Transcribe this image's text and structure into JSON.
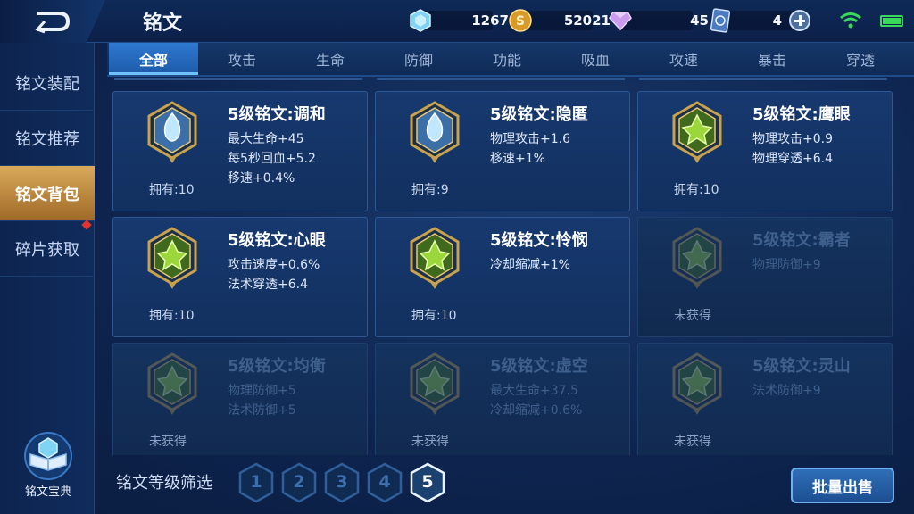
{
  "header": {
    "title": "铭文",
    "resources": [
      {
        "name": "crystal",
        "icon": "crystal-icon",
        "value": "1267"
      },
      {
        "name": "gold",
        "icon": "coin-icon",
        "value": "52021"
      },
      {
        "name": "diamond",
        "icon": "diamond-icon",
        "value": "45"
      },
      {
        "name": "card",
        "icon": "card-icon",
        "value": "4"
      }
    ]
  },
  "leftnav": {
    "items": [
      {
        "label": "铭文装配"
      },
      {
        "label": "铭文推荐"
      },
      {
        "label": "铭文背包",
        "active": true
      },
      {
        "label": "碎片获取"
      }
    ],
    "codex_label": "铭文宝典"
  },
  "tabs": [
    {
      "label": "全部",
      "active": true
    },
    {
      "label": "攻击"
    },
    {
      "label": "生命"
    },
    {
      "label": "防御"
    },
    {
      "label": "功能"
    },
    {
      "label": "吸血"
    },
    {
      "label": "攻速"
    },
    {
      "label": "暴击"
    },
    {
      "label": "穿透"
    }
  ],
  "cards": [
    {
      "name": "5级铭文:调和",
      "attrs": [
        "最大生命+45",
        "每5秒回血+5.2",
        "移速+0.4%"
      ],
      "owned": "拥有:10",
      "color": "blue",
      "obtained": true
    },
    {
      "name": "5级铭文:隐匿",
      "attrs": [
        "物理攻击+1.6",
        "移速+1%"
      ],
      "owned": "拥有:9",
      "color": "blue",
      "obtained": true
    },
    {
      "name": "5级铭文:鹰眼",
      "attrs": [
        "物理攻击+0.9",
        "物理穿透+6.4"
      ],
      "owned": "拥有:10",
      "color": "green",
      "obtained": true
    },
    {
      "name": "5级铭文:心眼",
      "attrs": [
        "攻击速度+0.6%",
        "法术穿透+6.4"
      ],
      "owned": "拥有:10",
      "color": "green",
      "obtained": true
    },
    {
      "name": "5级铭文:怜悯",
      "attrs": [
        "冷却缩减+1%"
      ],
      "owned": "拥有:10",
      "color": "green",
      "obtained": true
    },
    {
      "name": "5级铭文:霸者",
      "attrs": [
        "物理防御+9"
      ],
      "owned": "未获得",
      "color": "green",
      "obtained": false
    },
    {
      "name": "5级铭文:均衡",
      "attrs": [
        "物理防御+5",
        "法术防御+5"
      ],
      "owned": "未获得",
      "color": "green",
      "obtained": false
    },
    {
      "name": "5级铭文:虚空",
      "attrs": [
        "最大生命+37.5",
        "冷却缩减+0.6%"
      ],
      "owned": "未获得",
      "color": "green",
      "obtained": false
    },
    {
      "name": "5级铭文:灵山",
      "attrs": [
        "法术防御+9"
      ],
      "owned": "未获得",
      "color": "green",
      "obtained": false
    }
  ],
  "footer": {
    "filter_label": "铭文等级筛选",
    "levels": [
      "1",
      "2",
      "3",
      "4",
      "5"
    ],
    "selected_level": "5",
    "sell_label": "批量出售"
  },
  "colors": {
    "accent_blue": "#2e79d0",
    "active_nav": "#d9a95a",
    "gem_blue": "#bfe8ff",
    "gem_green": "#9bd63a"
  }
}
